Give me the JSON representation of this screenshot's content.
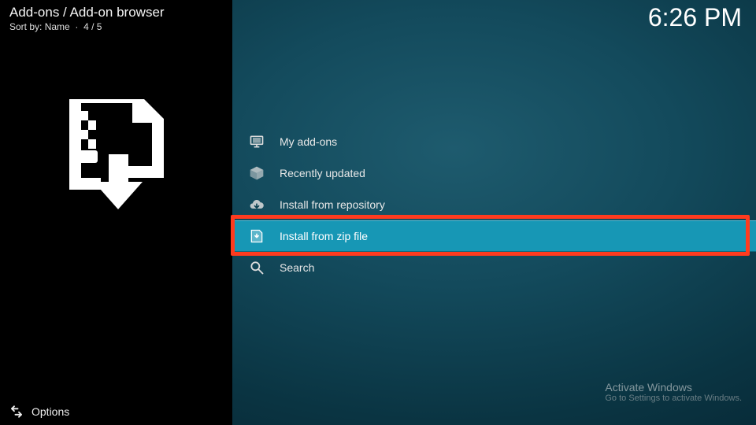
{
  "header": {
    "breadcrumb": "Add-ons / Add-on browser",
    "sort_label": "Sort by:",
    "sort_value": "Name",
    "position": "4 / 5",
    "clock": "6:26 PM"
  },
  "sidebar": {
    "options_label": "Options"
  },
  "menu": {
    "items": [
      {
        "label": "My add-ons",
        "icon": "monitor-icon",
        "selected": false
      },
      {
        "label": "Recently updated",
        "icon": "box-icon",
        "selected": false
      },
      {
        "label": "Install from repository",
        "icon": "cloud-download-icon",
        "selected": false
      },
      {
        "label": "Install from zip file",
        "icon": "zip-download-icon",
        "selected": true
      },
      {
        "label": "Search",
        "icon": "search-icon",
        "selected": false
      }
    ]
  },
  "annotation": {
    "highlight_target_index": 3
  },
  "watermark": {
    "line1": "Activate Windows",
    "line2": "Go to Settings to activate Windows."
  }
}
